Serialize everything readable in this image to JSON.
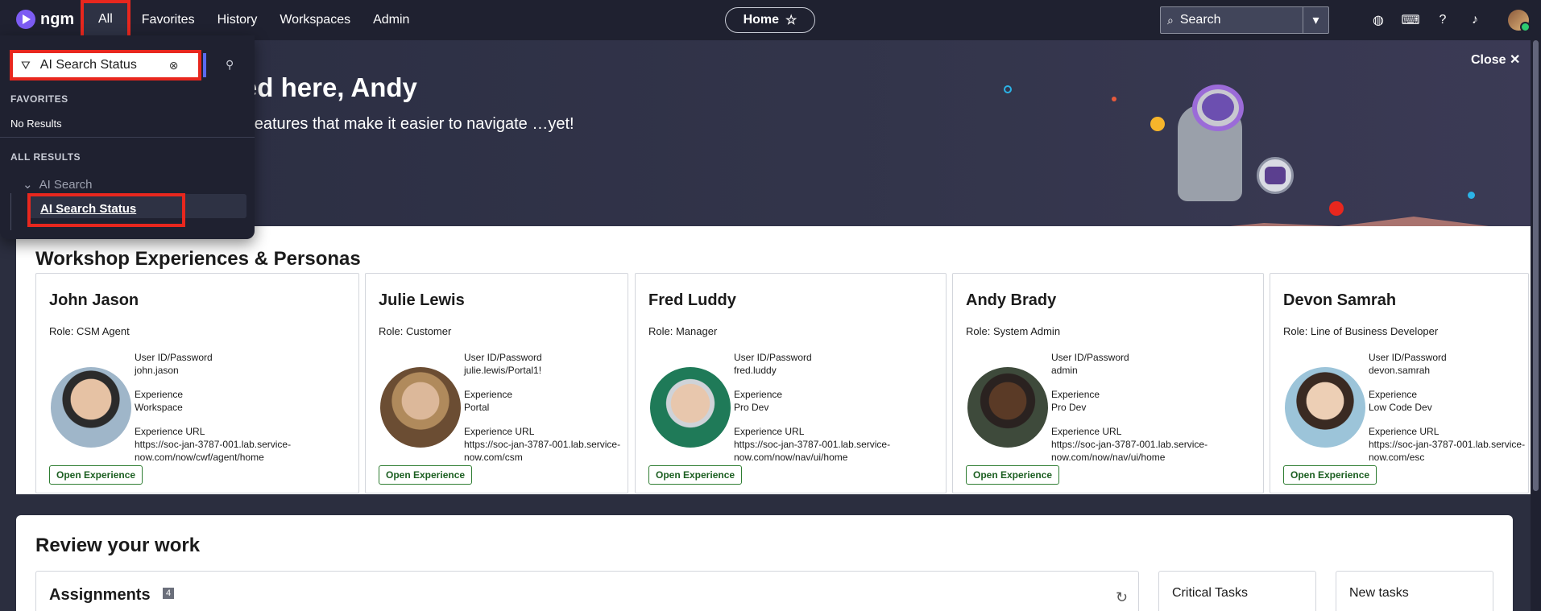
{
  "topbar": {
    "logo_text": "ngm",
    "nav": [
      "All",
      "Favorites",
      "History",
      "Workspaces",
      "Admin"
    ],
    "home_label": "Home",
    "search_placeholder": "Search"
  },
  "hero": {
    "title": "…ad you've landed here, Andy",
    "subtitle": "…to the moon with new menu features that make it easier to navigate …yet!",
    "close_label": "Close"
  },
  "menu": {
    "filter_value": "AI Search Status",
    "favorites_heading": "FAVORITES",
    "favorites_empty": "No Results",
    "all_results_heading": "ALL RESULTS",
    "group_label": "AI Search",
    "result_label": "AI Search Status"
  },
  "workshop": {
    "title": "Workshop Experiences & Personas",
    "id_label": "User ID/Password",
    "exp_label": "Experience",
    "url_label": "Experience URL",
    "button_label": "Open Experience",
    "personas": [
      {
        "name": "John Jason",
        "role": "Role: CSM Agent",
        "credentials": "john.jason",
        "experience": "Workspace",
        "url": "https://soc-jan-3787-001.lab.service-now.com/now/cwf/agent/home"
      },
      {
        "name": "Julie Lewis",
        "role": "Role: Customer",
        "credentials": "julie.lewis/Portal1!",
        "experience": "Portal",
        "url": "https://soc-jan-3787-001.lab.service-now.com/csm"
      },
      {
        "name": "Fred Luddy",
        "role": "Role: Manager",
        "credentials": "fred.luddy",
        "experience": "Pro Dev",
        "url": "https://soc-jan-3787-001.lab.service-now.com/now/nav/ui/home"
      },
      {
        "name": "Andy Brady",
        "role": "Role: System Admin",
        "credentials": "admin",
        "experience": "Pro Dev",
        "url": "https://soc-jan-3787-001.lab.service-now.com/now/nav/ui/home"
      },
      {
        "name": "Devon Samrah",
        "role": "Role: Line of Business Developer",
        "credentials": "devon.samrah",
        "experience": "Low Code Dev",
        "url": "https://soc-jan-3787-001.lab.service-now.com/esc"
      }
    ]
  },
  "review": {
    "title": "Review your work",
    "assignments_label": "Assignments",
    "assignments_count": "4",
    "critical_label": "Critical Tasks",
    "new_label": "New tasks"
  }
}
